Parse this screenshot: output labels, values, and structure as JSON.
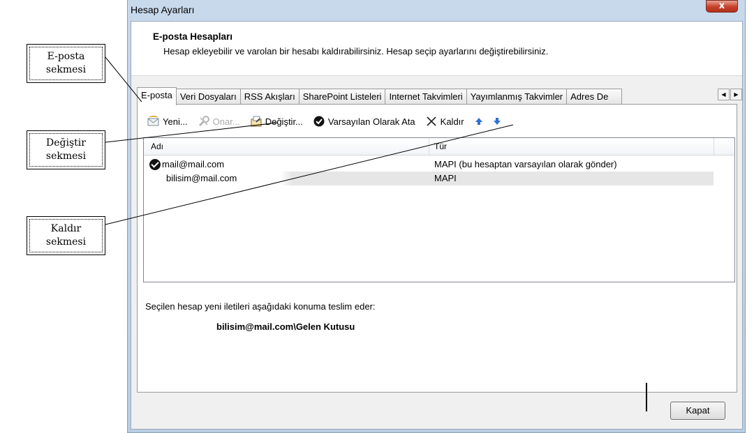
{
  "callouts": {
    "eposta": [
      "E-posta",
      "sekmesi"
    ],
    "degistir": [
      "Değiştir",
      "sekmesi"
    ],
    "kaldir": [
      "Kaldır",
      "sekmesi"
    ]
  },
  "window": {
    "title": "Hesap Ayarları",
    "close_label": "x"
  },
  "header": {
    "title": "E-posta Hesapları",
    "description": "Hesap ekleyebilir ve varolan bir hesabı kaldırabilirsiniz. Hesap seçip ayarlarını değiştirebilirsiniz."
  },
  "tabs": [
    "E-posta",
    "Veri Dosyaları",
    "RSS Akışları",
    "SharePoint Listeleri",
    "Internet Takvimleri",
    "Yayımlanmış Takvimler",
    "Adres De"
  ],
  "toolbar": {
    "new": "Yeni...",
    "repair": "Onar...",
    "change": "Değiştir...",
    "set_default": "Varsayılan Olarak Ata",
    "remove": "Kaldır"
  },
  "list": {
    "columns": [
      "Adı",
      "Tür"
    ],
    "rows": [
      {
        "name": "mail@mail.com",
        "type": "MAPI (bu hesaptan varsayılan olarak gönder)"
      },
      {
        "name": "bilisim@mail.com",
        "type": "MAPI"
      }
    ]
  },
  "delivery": {
    "label": "Seçilen hesap yeni iletileri aşağıdaki konuma teslim eder:",
    "path": "bilisim@mail.com\\Gelen Kutusu"
  },
  "buttons": {
    "close": "Kapat"
  },
  "colors": {
    "window_frame": "#c9d9ec",
    "close_button": "#c6412a",
    "arrow_blue": "#2f6fd6"
  }
}
